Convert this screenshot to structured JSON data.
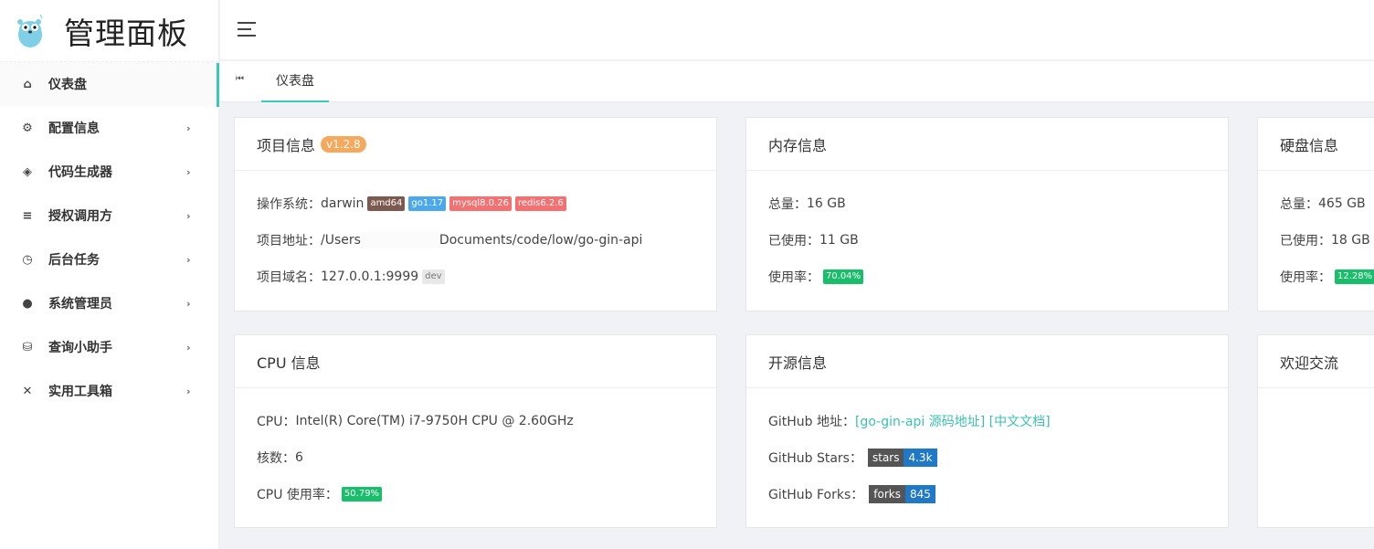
{
  "app": {
    "title": "管理面板"
  },
  "sidebar": {
    "items": [
      {
        "label": "仪表盘",
        "icon": "home-icon",
        "glyph": "⌂",
        "has_children": false
      },
      {
        "label": "配置信息",
        "icon": "settings-icon",
        "glyph": "⚙",
        "has_children": true
      },
      {
        "label": "代码生成器",
        "icon": "code-icon",
        "glyph": "◈",
        "has_children": true
      },
      {
        "label": "授权调用方",
        "icon": "checklist-icon",
        "glyph": "≡",
        "has_children": true
      },
      {
        "label": "后台任务",
        "icon": "timer-icon",
        "glyph": "◷",
        "has_children": true
      },
      {
        "label": "系统管理员",
        "icon": "user-icon",
        "glyph": "●",
        "has_children": true
      },
      {
        "label": "查询小助手",
        "icon": "database-search-icon",
        "glyph": "⛁",
        "has_children": true
      },
      {
        "label": "实用工具箱",
        "icon": "tools-icon",
        "glyph": "✕",
        "has_children": true
      }
    ],
    "chevron": "›"
  },
  "tabs": {
    "prev": "⏮",
    "items": [
      {
        "label": "仪表盘"
      }
    ]
  },
  "project": {
    "title": "项目信息",
    "version": "v1.2.8",
    "os_label": "操作系统：",
    "os": "darwin",
    "arch": "amd64",
    "go": "go1.17",
    "mysql": "mysql8.0.26",
    "redis": "redis6.2.6",
    "path_label": "项目地址：",
    "path_start": "/Users",
    "path_end": "Documents/code/low/go-gin-api",
    "domain_label": "项目域名：",
    "domain": "127.0.0.1:9999",
    "env": "dev"
  },
  "memory": {
    "title": "内存信息",
    "total_label": "总量：",
    "total": "16 GB",
    "used_label": "已使用：",
    "used": "11 GB",
    "rate_label": "使用率：",
    "rate": "70.04%"
  },
  "disk": {
    "title": "硬盘信息",
    "total_label": "总量：",
    "total": "465 GB",
    "used_label": "已使用：",
    "used": "18 GB",
    "rate_label": "使用率：",
    "rate": "12.28%"
  },
  "cpu": {
    "title": "CPU 信息",
    "model_label": "CPU：",
    "model": "Intel(R) Core(TM) i7-9750H CPU @ 2.60GHz",
    "cores_label": "核数：",
    "cores": "6",
    "rate_label": "CPU 使用率：",
    "rate": "50.79%"
  },
  "opensource": {
    "title": "开源信息",
    "addr_label": "GitHub 地址：",
    "link1": "[go-gin-api 源码地址]",
    "link2": "[中文文档]",
    "stars_label": "GitHub Stars：",
    "stars_key": "stars",
    "stars": "4.3k",
    "forks_label": "GitHub Forks：",
    "forks_key": "forks",
    "forks": "845"
  },
  "welcome": {
    "title": "欢迎交流"
  },
  "colors": {
    "accent": "#3cc7b7",
    "arch": "#7d5a4f",
    "go": "#4aa8ee",
    "db": "#f57070",
    "version": "#f6a85c",
    "usage": "#19be6b",
    "badge_value": "#1f78c8"
  }
}
